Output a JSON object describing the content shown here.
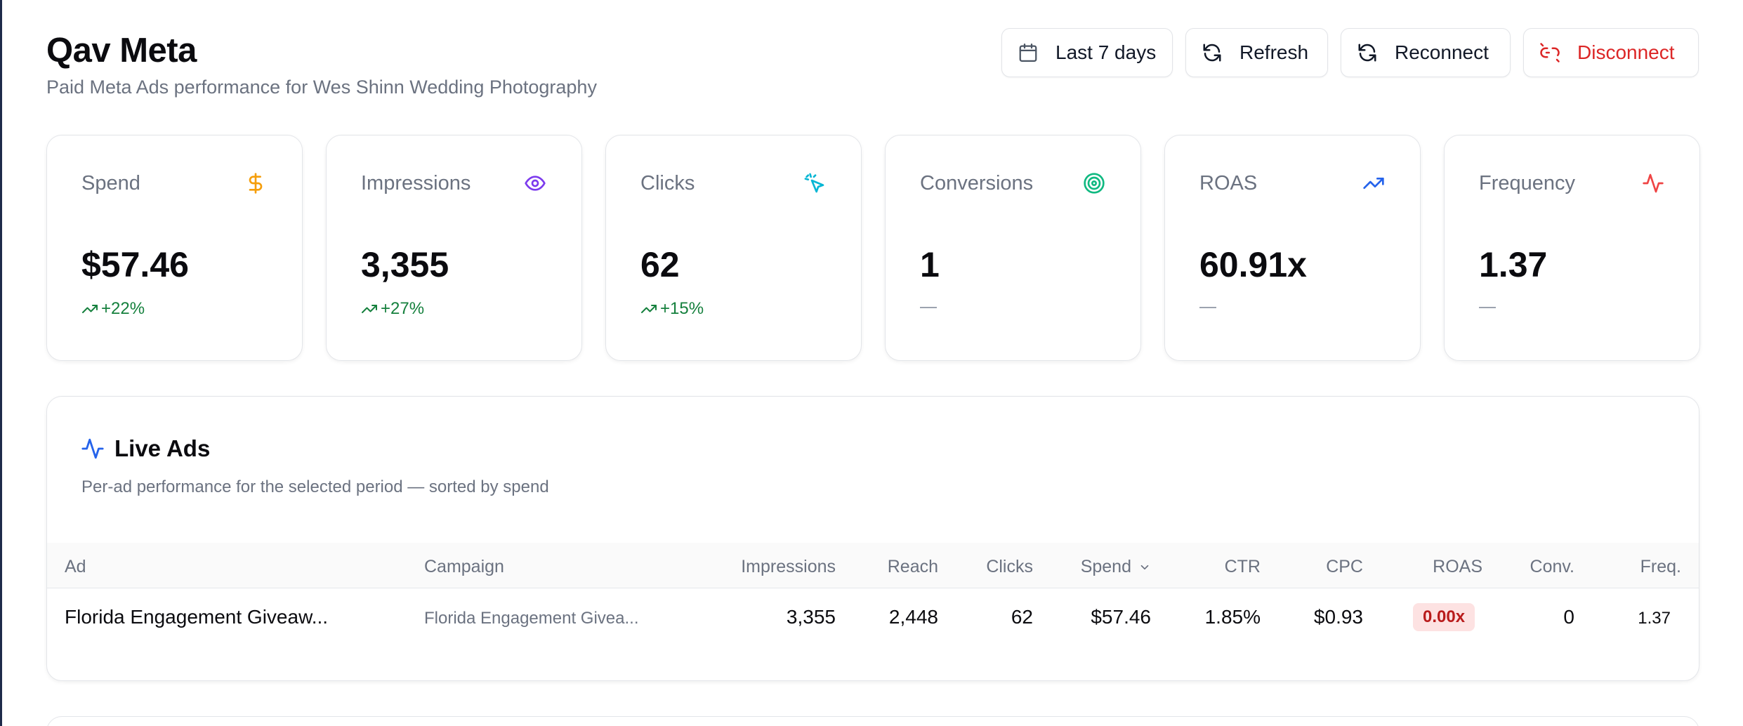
{
  "header": {
    "title": "Qav Meta",
    "subtitle": "Paid Meta Ads performance for Wes Shinn Wedding Photography"
  },
  "actions": {
    "date_range": "Last 7 days",
    "refresh": "Refresh",
    "reconnect": "Reconnect",
    "disconnect": "Disconnect"
  },
  "kpis": [
    {
      "label": "Spend",
      "value": "$57.46",
      "delta": "+22%",
      "icon": "dollar-icon",
      "color": "#f59e0b"
    },
    {
      "label": "Impressions",
      "value": "3,355",
      "delta": "+27%",
      "icon": "eye-icon",
      "color": "#7c3aed"
    },
    {
      "label": "Clicks",
      "value": "62",
      "delta": "+15%",
      "icon": "cursor-click-icon",
      "color": "#06b6d4"
    },
    {
      "label": "Conversions",
      "value": "1",
      "delta": "—",
      "icon": "target-icon",
      "color": "#10b981"
    },
    {
      "label": "ROAS",
      "value": "60.91x",
      "delta": "—",
      "icon": "trending-up-icon",
      "color": "#2563eb"
    },
    {
      "label": "Frequency",
      "value": "1.37",
      "delta": "—",
      "icon": "activity-icon",
      "color": "#ef4444"
    }
  ],
  "live_ads": {
    "title": "Live Ads",
    "subtitle": "Per-ad performance for the selected period — sorted by spend",
    "columns": {
      "ad": "Ad",
      "campaign": "Campaign",
      "impressions": "Impressions",
      "reach": "Reach",
      "clicks": "Clicks",
      "spend": "Spend",
      "ctr": "CTR",
      "cpc": "CPC",
      "roas": "ROAS",
      "conv": "Conv.",
      "freq": "Freq."
    },
    "rows": [
      {
        "ad": "Florida Engagement Giveaw...",
        "campaign": "Florida Engagement Givea...",
        "impressions": "3,355",
        "reach": "2,448",
        "clicks": "62",
        "spend": "$57.46",
        "ctr": "1.85%",
        "cpc": "$0.93",
        "roas": "0.00x",
        "conv": "0",
        "freq": "1.37"
      }
    ]
  },
  "colors": {
    "positive": "#15803d",
    "danger": "#dc2626",
    "accent": "#2563eb"
  }
}
